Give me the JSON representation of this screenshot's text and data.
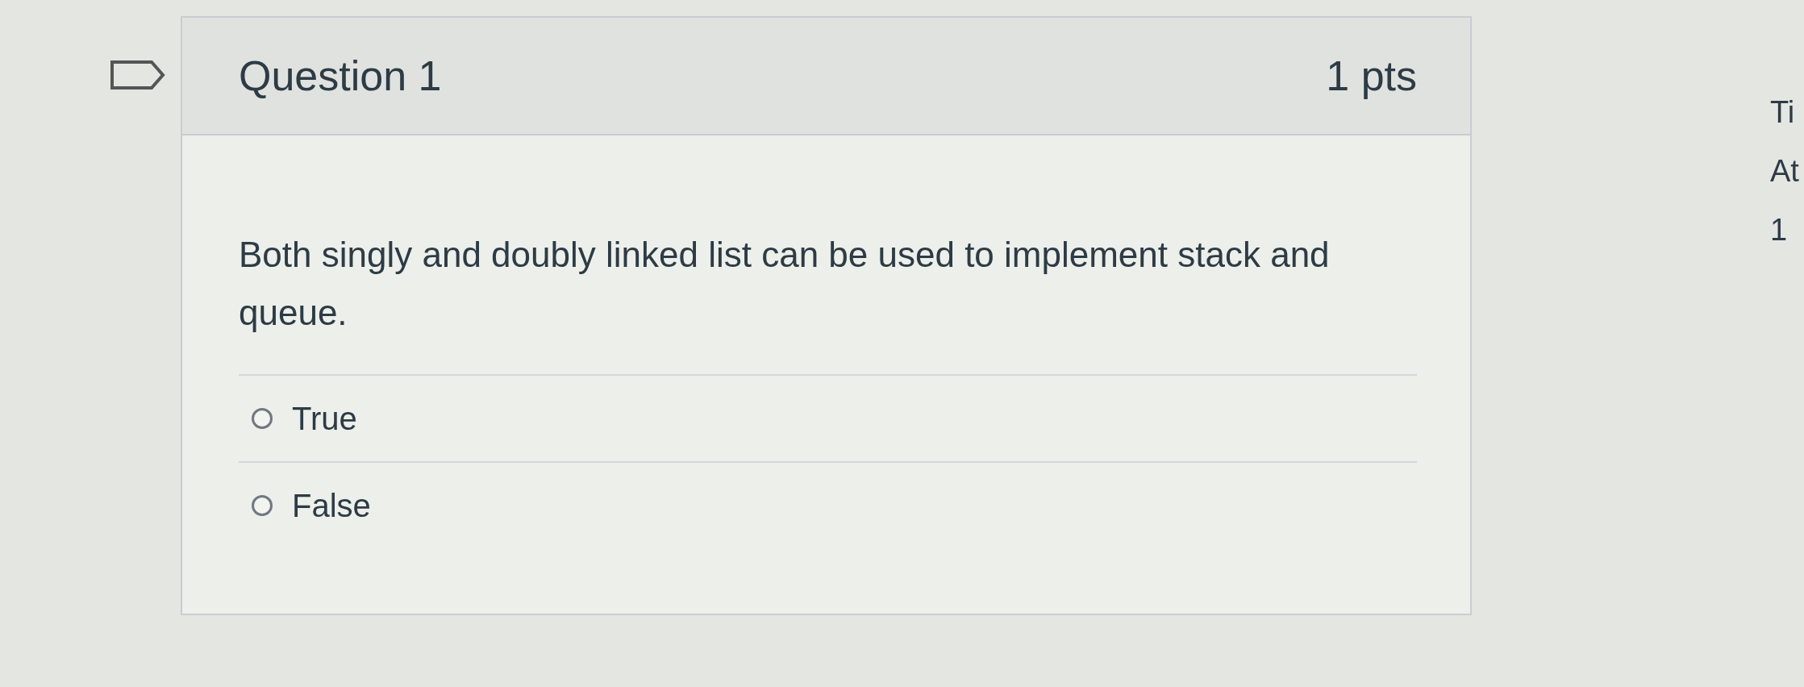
{
  "question": {
    "title": "Question 1",
    "points": "1 pts",
    "text": "Both singly and doubly linked list can be used to implement stack and queue.",
    "answers": [
      {
        "label": "True",
        "selected": false
      },
      {
        "label": "False",
        "selected": false
      }
    ]
  },
  "sidebar": {
    "items": [
      "Ti",
      "At",
      "1"
    ]
  }
}
